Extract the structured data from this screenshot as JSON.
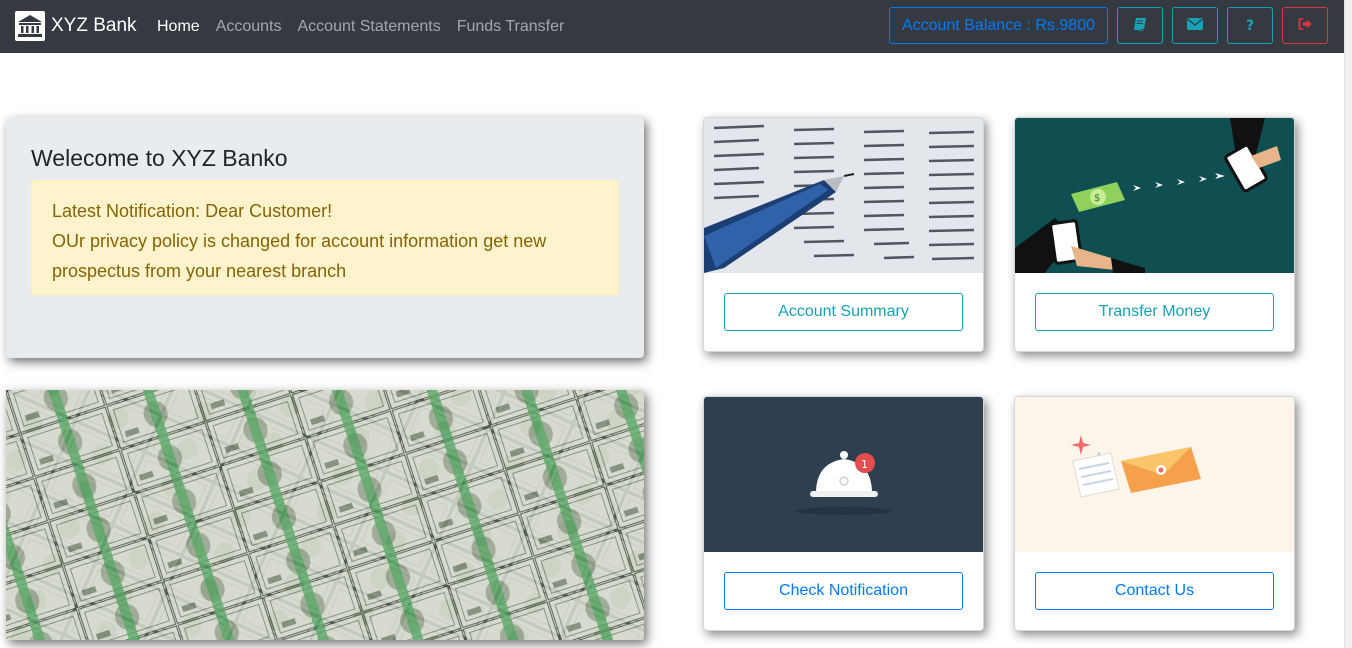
{
  "brand": {
    "name": "XYZ Bank",
    "icon": "bank-icon"
  },
  "nav": {
    "links": [
      {
        "label": "Home",
        "active": true
      },
      {
        "label": "Accounts",
        "active": false
      },
      {
        "label": "Account Statements",
        "active": false
      },
      {
        "label": "Funds Transfer",
        "active": false
      }
    ],
    "balance_label": "Account Balance : Rs.9800",
    "icon_buttons": [
      "book-icon",
      "envelope-icon",
      "question-icon",
      "sign-out-icon"
    ]
  },
  "welcome": {
    "title": "Welecome to XYZ Banko",
    "notification_head": "Latest Notification:",
    "notification_greeting": " Dear Customer!",
    "notification_body": "OUr privacy policy is changed for account information get new prospectus from your nearest branch"
  },
  "cards": [
    {
      "label": "Account Summary",
      "image": "financial-statement-image"
    },
    {
      "label": "Transfer Money",
      "image": "money-transfer-image"
    },
    {
      "label": "Check Notification",
      "image": "notification-bell-image"
    },
    {
      "label": "Contact Us",
      "image": "contact-envelope-image"
    }
  ],
  "colors": {
    "navbar": "#343a40",
    "primary": "#007bff",
    "info": "#17a2b8",
    "danger": "#dc3545",
    "alert_bg": "#fff3cd",
    "alert_text": "#856404",
    "jumbotron": "#e9ecef"
  }
}
